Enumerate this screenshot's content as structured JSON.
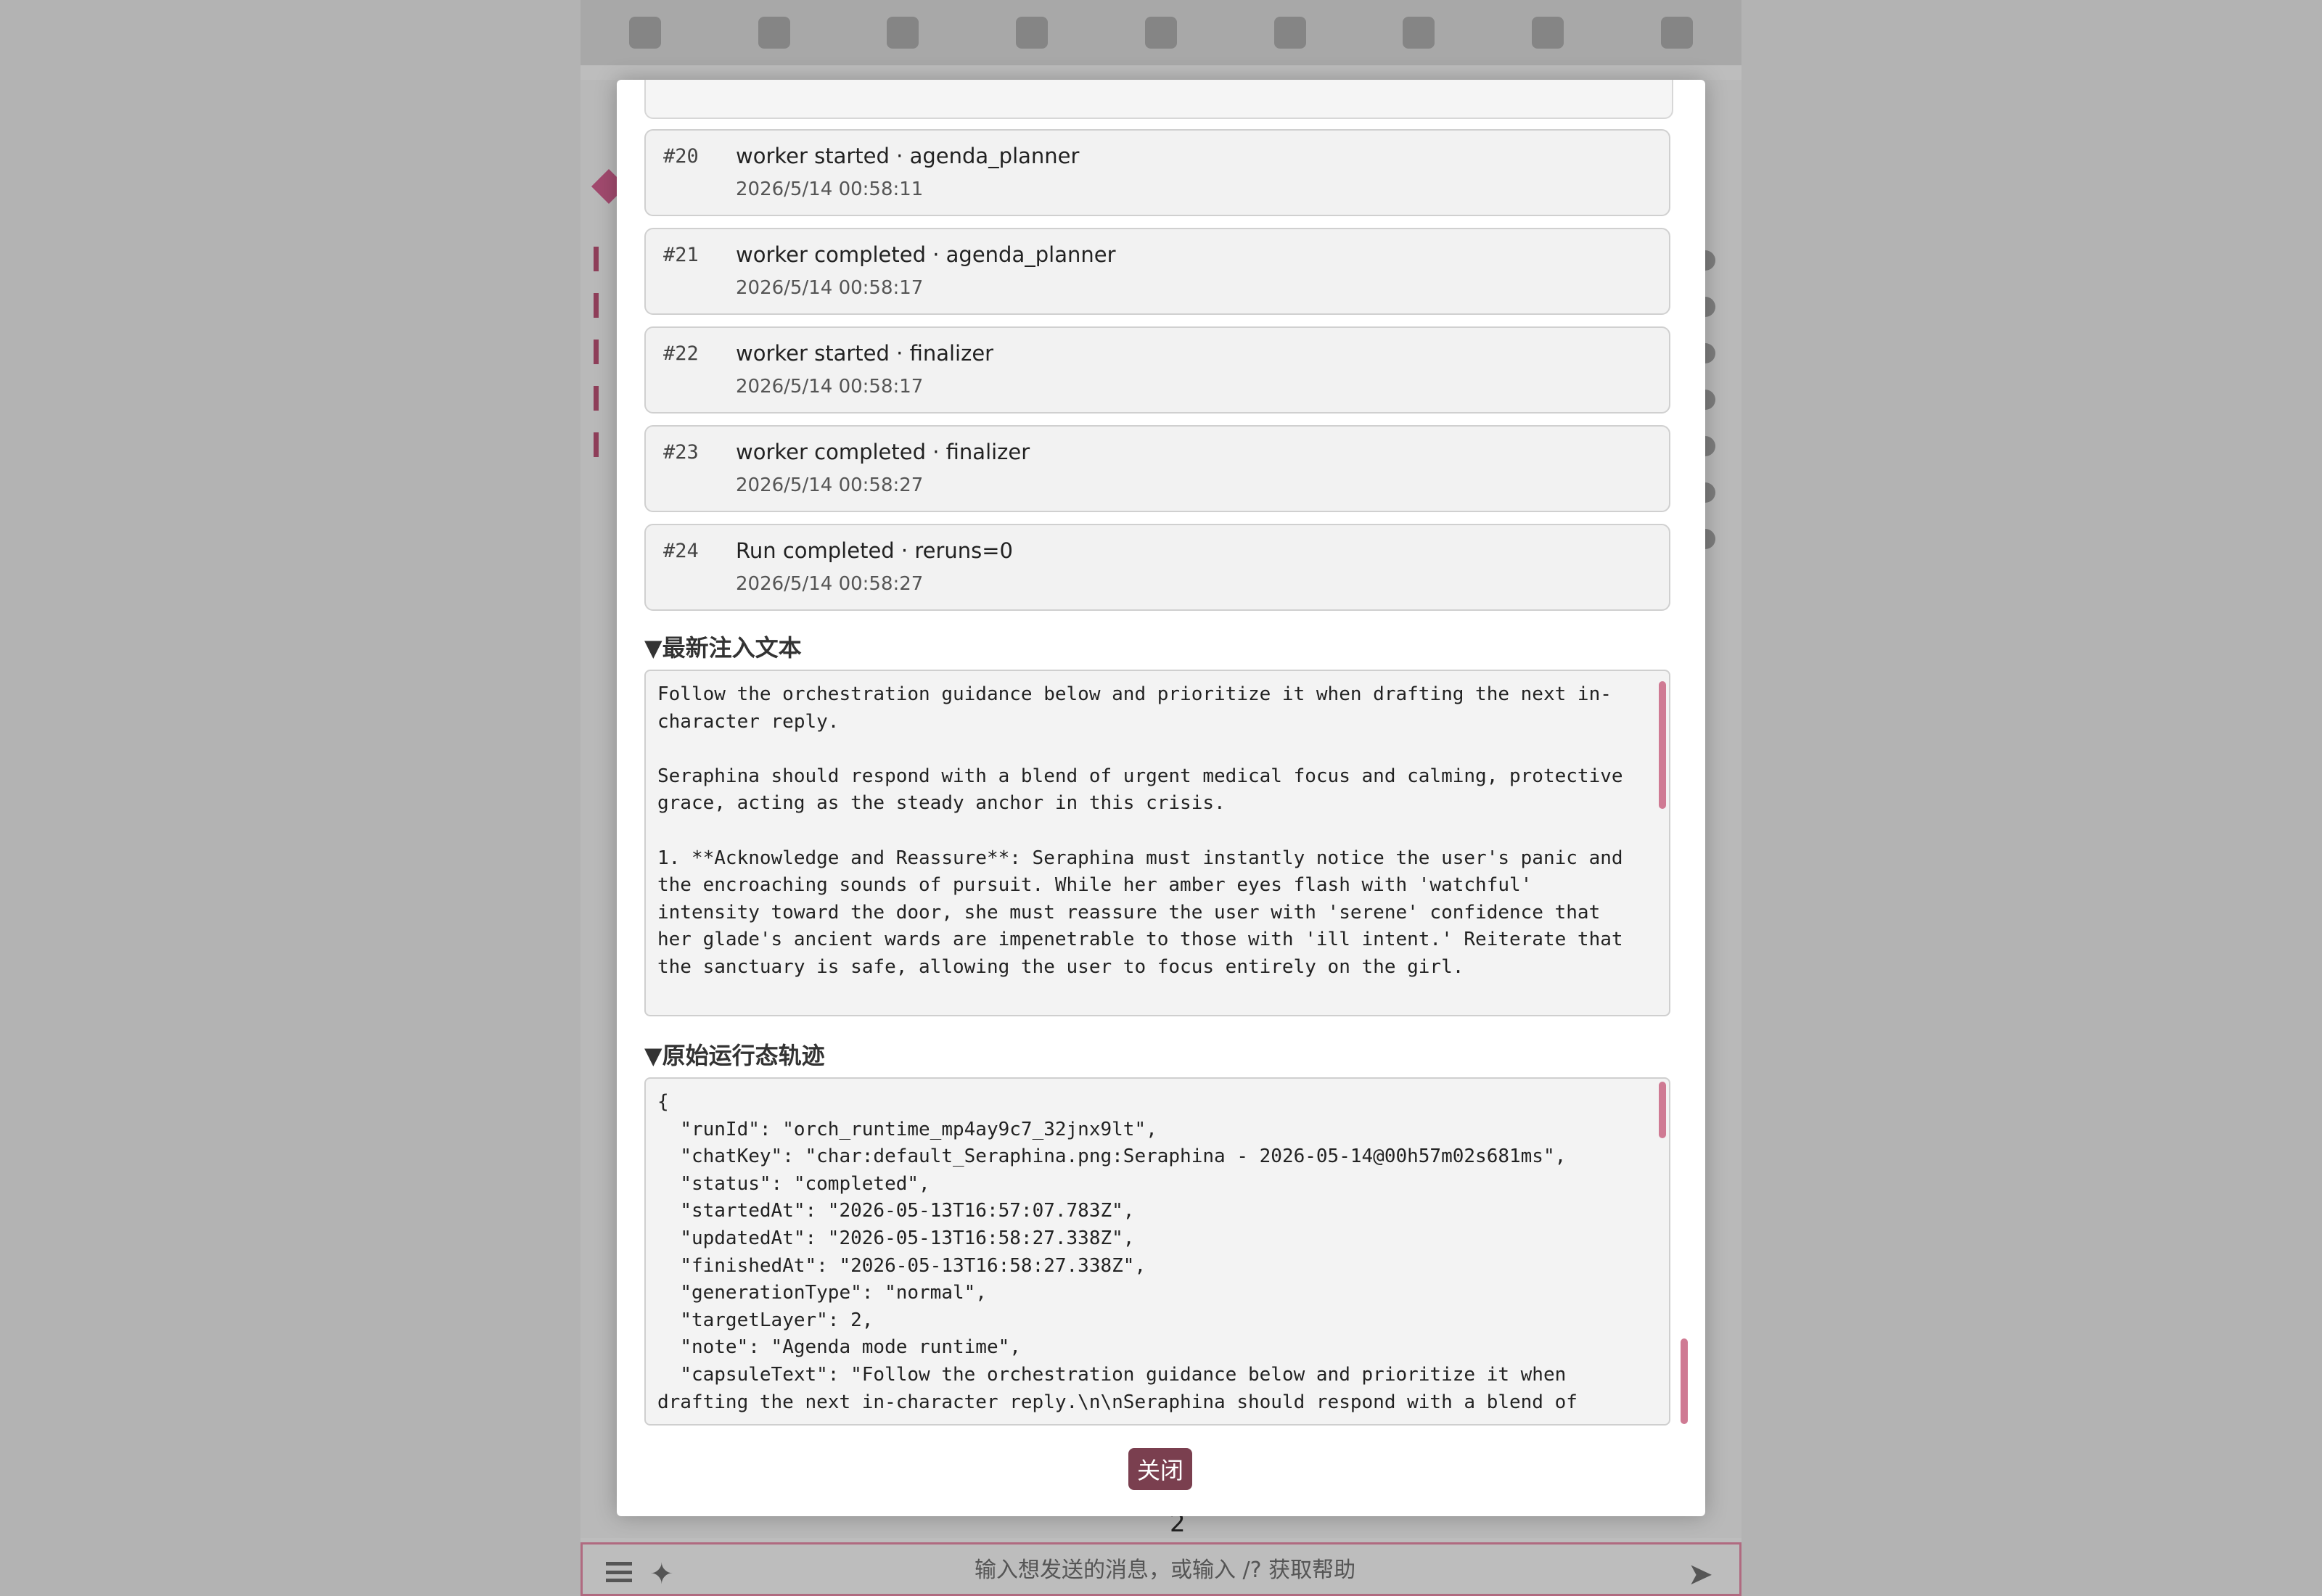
{
  "background": {
    "input_placeholder": "输入想发送的消息，或输入 /? 获取帮助",
    "page_number": "2",
    "toolbar_icons": [
      "sliders-icon",
      "plug-icon",
      "font-icon",
      "book-icon",
      "user-gear-icon",
      "image-icon",
      "cubes-icon",
      "smile-icon",
      "id-card-icon"
    ]
  },
  "events": [
    {
      "num": "#20",
      "title": "worker started · agenda_planner",
      "time": "2026/5/14 00:58:11"
    },
    {
      "num": "#21",
      "title": "worker completed · agenda_planner",
      "time": "2026/5/14 00:58:17"
    },
    {
      "num": "#22",
      "title": "worker started · finalizer",
      "time": "2026/5/14 00:58:17"
    },
    {
      "num": "#23",
      "title": "worker completed · finalizer",
      "time": "2026/5/14 00:58:27"
    },
    {
      "num": "#24",
      "title": "Run completed · reruns=0",
      "time": "2026/5/14 00:58:27"
    }
  ],
  "injected": {
    "heading": "▼最新注入文本",
    "text": "Follow the orchestration guidance below and prioritize it when drafting the next in-character reply.\n\nSeraphina should respond with a blend of urgent medical focus and calming, protective grace, acting as the steady anchor in this crisis.\n\n1. **Acknowledge and Reassure**: Seraphina must instantly notice the user's panic and the encroaching sounds of pursuit. While her amber eyes flash with 'watchful' intensity toward the door, she must reassure the user with 'serene' confidence that her glade's ancient wards are impenetrable to those with 'ill intent.' Reiterate that the sanctuary is safe, allowing the user to focus entirely on the girl."
  },
  "trace": {
    "heading": "▼原始运行态轨迹",
    "text": "{\n  \"runId\": \"orch_runtime_mp4ay9c7_32jnx9lt\",\n  \"chatKey\": \"char:default_Seraphina.png:Seraphina - 2026-05-14@00h57m02s681ms\",\n  \"status\": \"completed\",\n  \"startedAt\": \"2026-05-13T16:57:07.783Z\",\n  \"updatedAt\": \"2026-05-13T16:58:27.338Z\",\n  \"finishedAt\": \"2026-05-13T16:58:27.338Z\",\n  \"generationType\": \"normal\",\n  \"targetLayer\": 2,\n  \"note\": \"Agenda mode runtime\",\n  \"capsuleText\": \"Follow the orchestration guidance below and prioritize it when drafting the next in-character reply.\\n\\nSeraphina should respond with a blend of"
  },
  "close_label": "关闭"
}
